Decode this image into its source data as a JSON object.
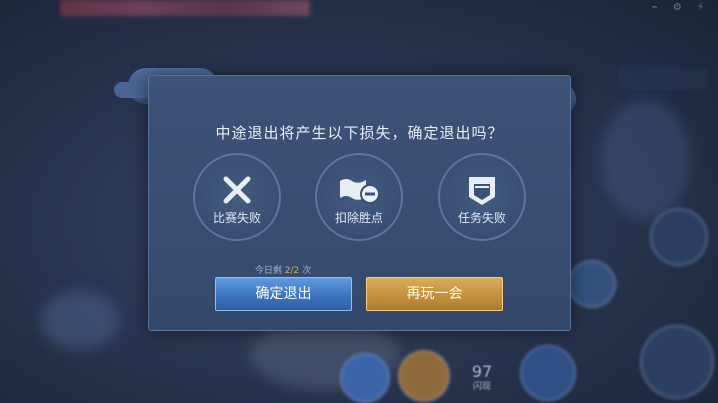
{
  "dialog": {
    "title": "中途退出将产生以下损失，确定退出吗？",
    "losses": [
      {
        "label": "比赛失败",
        "icon": "crossed-swords-icon"
      },
      {
        "label": "扣除胜点",
        "icon": "flag-minus-icon"
      },
      {
        "label": "任务失败",
        "icon": "shield-badge-icon"
      }
    ],
    "remaining": {
      "prefix": "今日剩",
      "value": "2/2",
      "suffix": "次"
    },
    "confirm_label": "确定退出",
    "again_label": "再玩一会"
  },
  "background": {
    "skill_count": "97",
    "skill_caption": "闪现"
  },
  "colors": {
    "dialog_bg": "#3b5176",
    "confirm_blue": "#3f74bf",
    "again_gold": "#c4913f",
    "remaining_highlight": "#e0b450"
  }
}
